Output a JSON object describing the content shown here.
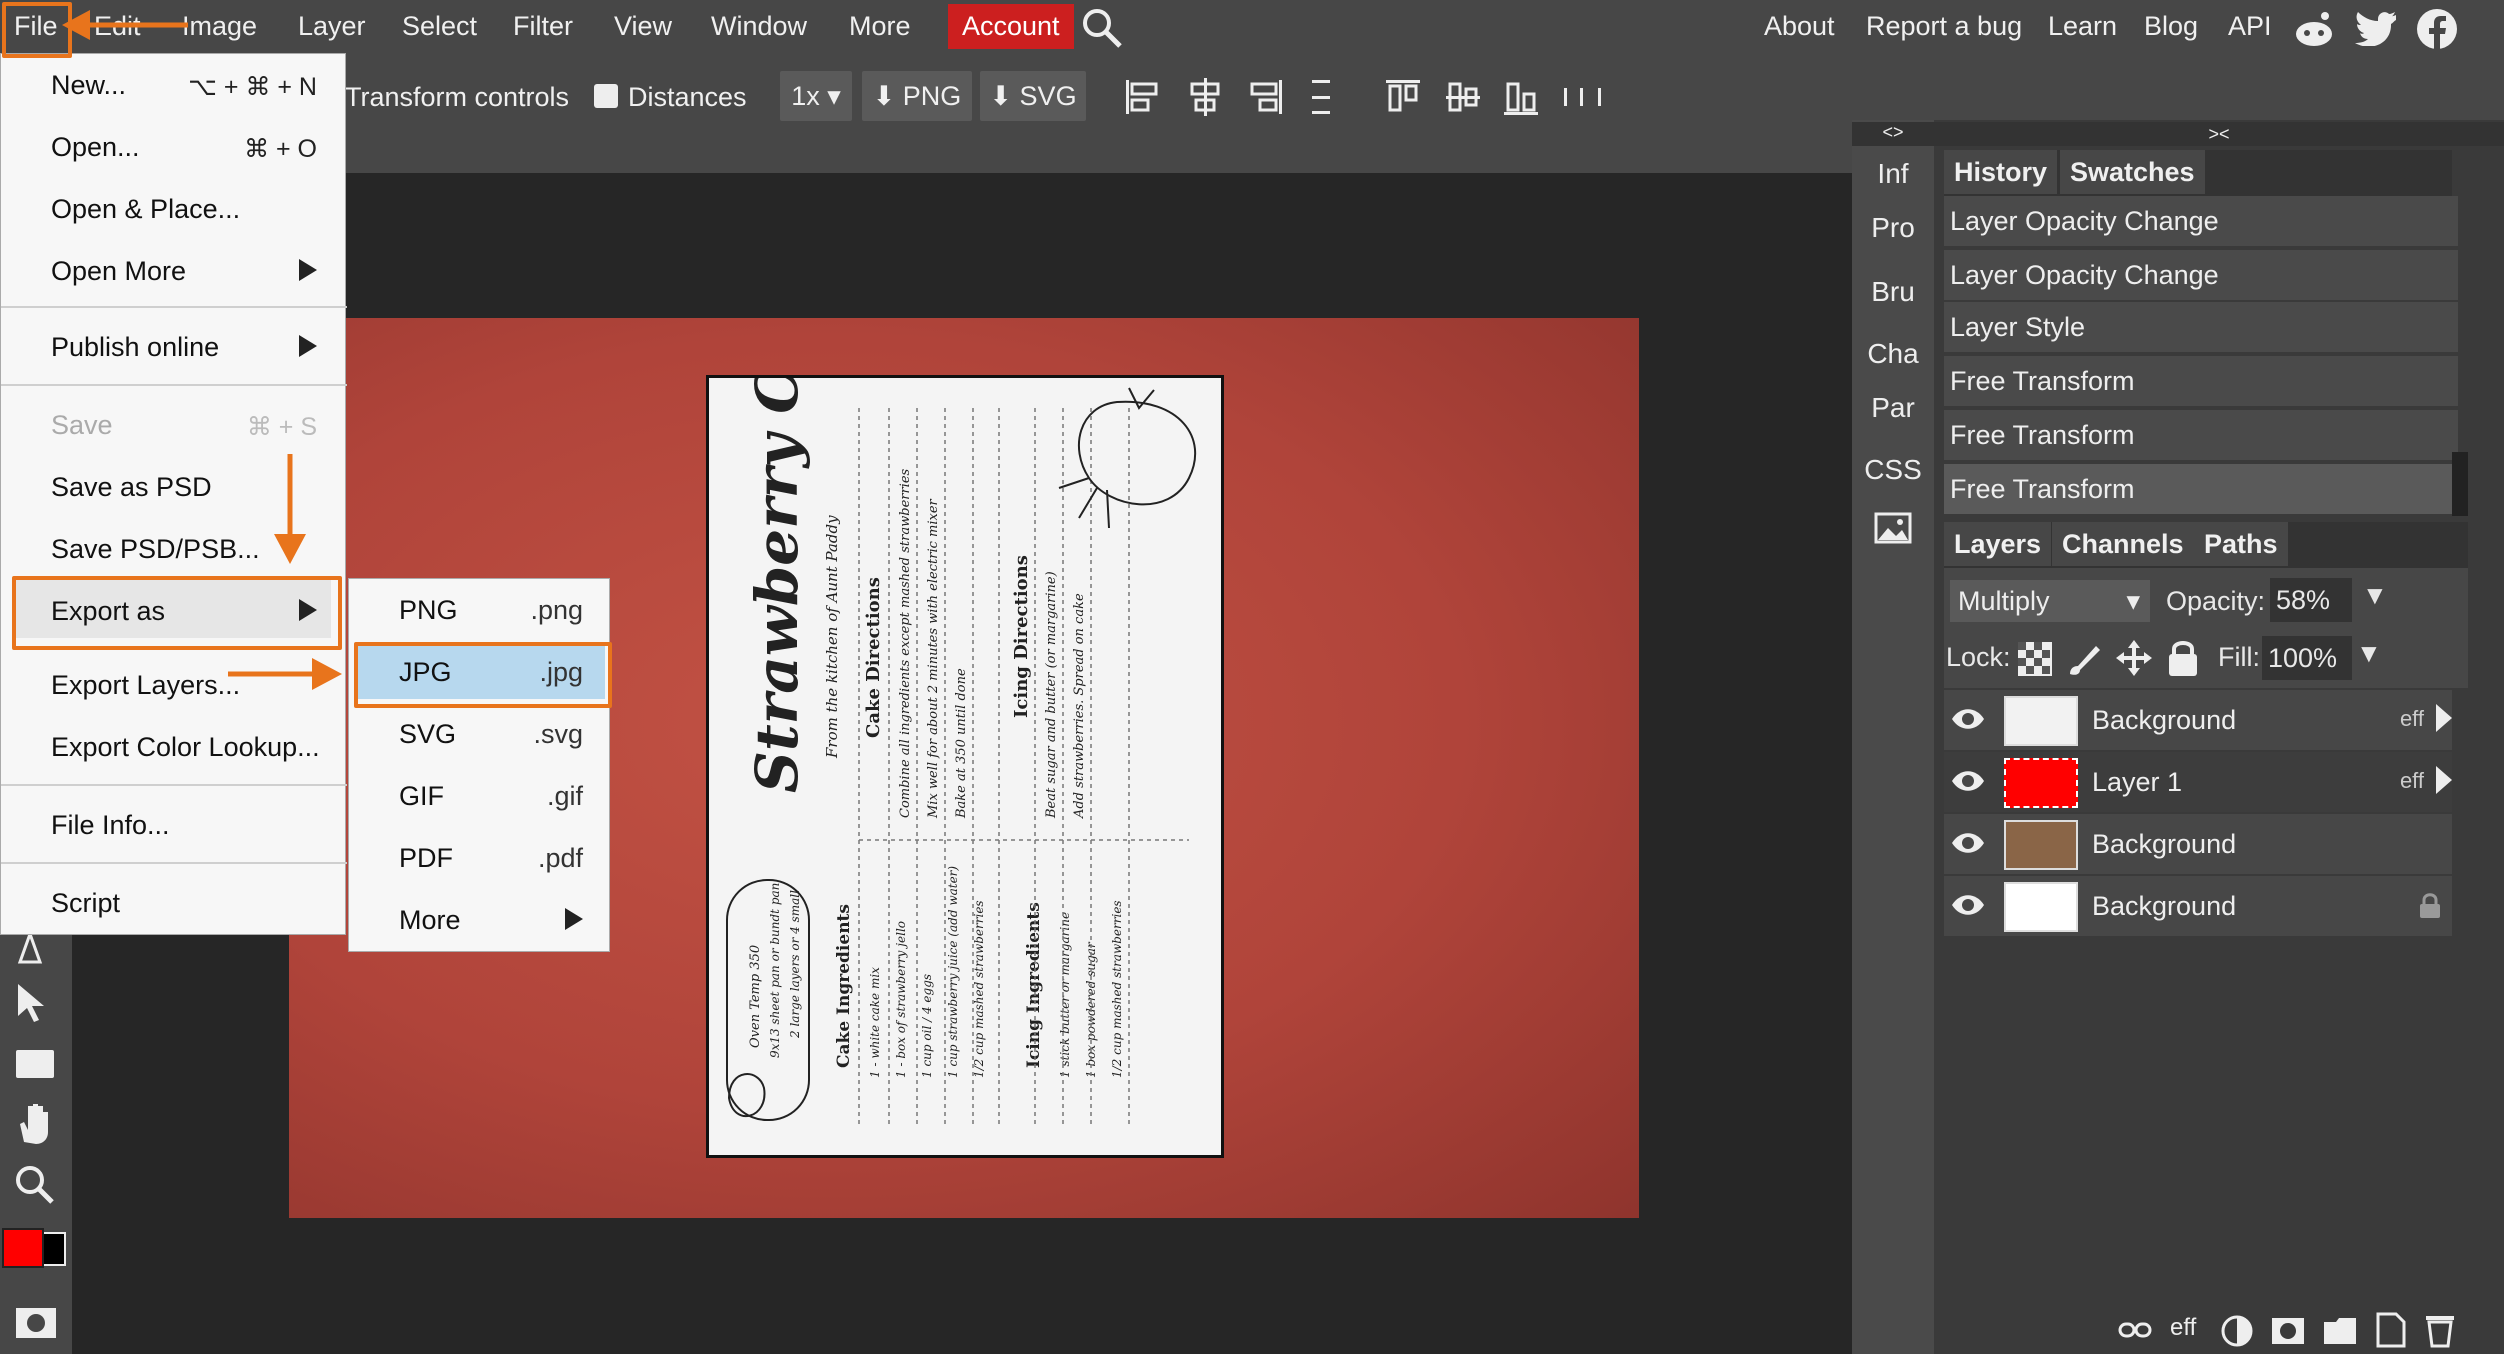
{
  "menubar": {
    "items": [
      "File",
      "Edit",
      "Image",
      "Layer",
      "Select",
      "Filter",
      "View",
      "Window",
      "More",
      "Account"
    ],
    "right_links": [
      "About",
      "Report a bug",
      "Learn",
      "Blog",
      "API"
    ],
    "social_icons": [
      "reddit-icon",
      "twitter-icon",
      "facebook-icon"
    ]
  },
  "options_bar": {
    "transform_label": "Transform controls",
    "distances_label": "Distances",
    "zoom_value": "1x",
    "png_label": "PNG",
    "svg_label": "SVG"
  },
  "file_menu": {
    "new": "New...",
    "new_shortcut": "⌥ + ⌘ + N",
    "open": "Open...",
    "open_shortcut": "⌘ + O",
    "open_place": "Open & Place...",
    "open_more": "Open More",
    "publish": "Publish online",
    "save": "Save",
    "save_shortcut": "⌘ + S",
    "save_psd": "Save as PSD",
    "save_psd_psb": "Save PSD/PSB...",
    "export_as": "Export as",
    "export_layers": "Export Layers...",
    "export_lookup": "Export Color Lookup...",
    "file_info": "File Info...",
    "script": "Script"
  },
  "export_submenu": [
    {
      "label": "PNG",
      "ext": ".png"
    },
    {
      "label": "JPG",
      "ext": ".jpg"
    },
    {
      "label": "SVG",
      "ext": ".svg"
    },
    {
      "label": "GIF",
      "ext": ".gif"
    },
    {
      "label": "PDF",
      "ext": ".pdf"
    },
    {
      "label": "More",
      "ext": ""
    }
  ],
  "side_strip": {
    "collapse_left": "<>",
    "items": [
      "Inf",
      "Pro",
      "Bru",
      "Cha",
      "Par",
      "CSS"
    ]
  },
  "panels": {
    "collapse_right": "><",
    "history_tab": "History",
    "swatches_tab": "Swatches",
    "history": [
      "Layer Opacity Change",
      "Layer Opacity Change",
      "Layer Style",
      "Free Transform",
      "Free Transform",
      "Free Transform"
    ],
    "layers_tab": "Layers",
    "channels_tab": "Channels",
    "paths_tab": "Paths",
    "blend_mode": "Multiply",
    "opacity_label": "Opacity:",
    "opacity_value": "58%",
    "lock_label": "Lock:",
    "fill_label": "Fill:",
    "fill_value": "100%",
    "layers": [
      {
        "name": "Background",
        "badge": "eff"
      },
      {
        "name": "Layer 1",
        "badge": "eff"
      },
      {
        "name": "Background",
        "badge": ""
      },
      {
        "name": "Background",
        "badge": ""
      }
    ],
    "footer_eff": "eff"
  },
  "card": {
    "title": "Strawberry Cake",
    "subtitle": "From the kitchen of Aunt Paddy",
    "cake_directions_head": "Cake Directions",
    "cake_directions": [
      "Combine all ingredients except mashed strawberries",
      "Mix well for about 2 minutes with electric mixer",
      "Bake at 350 until done"
    ],
    "icing_directions_head": "Icing Directions",
    "icing_directions": [
      "Beat sugar and butter (or margarine)",
      "Add strawberries. Spread on cake"
    ],
    "oven": [
      "Oven Temp 350",
      "9x13 sheet pan or bundt pan",
      "2 large layers or 4 small"
    ],
    "cake_ingredients_head": "Cake Ingredients",
    "cake_ingredients": [
      "1 - white cake mix",
      "1 - box of strawberry jello",
      "1 cup oil / 4 eggs",
      "1 cup strawberry juice (add water)",
      "1/2 cup mashed strawberries"
    ],
    "icing_ingredients_head": "Icing Ingredients",
    "icing_ingredients": [
      "1 stick butter or margarine",
      "1 box powdered sugar",
      "1/2 cup mashed strawberries"
    ]
  },
  "colors": {
    "accent_orange": "#e8741c",
    "account_red": "#cc1f1f",
    "foreground_color": "#ff0000",
    "background_color": "#000000",
    "layer1_thumb": "#ff0000"
  }
}
